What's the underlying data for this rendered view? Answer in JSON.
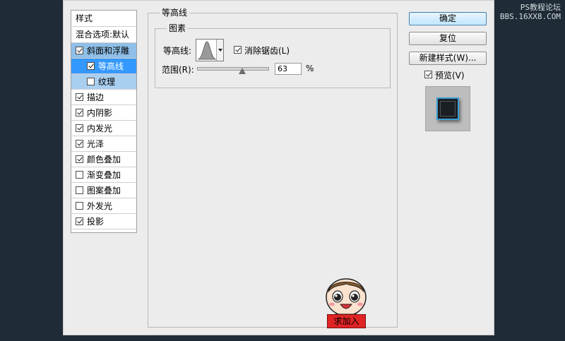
{
  "watermark": {
    "line1": "PS教程论坛",
    "line2": "BBS.16XX8.COM"
  },
  "styles_panel": {
    "title": "样式",
    "blend_options": "混合选项:默认",
    "items": [
      {
        "label": "斜面和浮雕",
        "checked": true
      },
      {
        "label": "等高线",
        "checked": true
      },
      {
        "label": "纹理",
        "checked": false
      },
      {
        "label": "描边",
        "checked": true
      },
      {
        "label": "内阴影",
        "checked": true
      },
      {
        "label": "内发光",
        "checked": true
      },
      {
        "label": "光泽",
        "checked": true
      },
      {
        "label": "颜色叠加",
        "checked": true
      },
      {
        "label": "渐变叠加",
        "checked": false
      },
      {
        "label": "图案叠加",
        "checked": false
      },
      {
        "label": "外发光",
        "checked": false
      },
      {
        "label": "投影",
        "checked": true
      }
    ]
  },
  "contour_section": {
    "title": "等高线",
    "element_group_title": "图素",
    "contour_label": "等高线:",
    "antialias_label": "消除锯齿(L)",
    "antialias_checked": true,
    "range_label": "范围(R):",
    "range_value": "63",
    "range_percent": 63,
    "percent_symbol": "%"
  },
  "buttons": {
    "ok": "确定",
    "reset": "复位",
    "new_style": "新建样式(W)...",
    "preview_label": "预览(V)",
    "preview_checked": true
  },
  "mascot": {
    "sign_text": "求加入"
  }
}
